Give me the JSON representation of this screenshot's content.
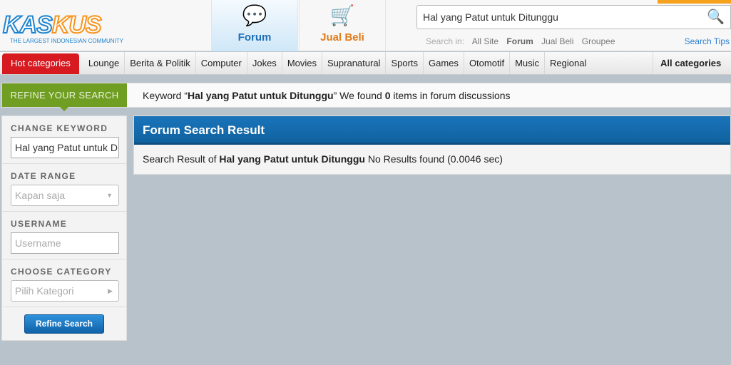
{
  "logo": {
    "text_blue": "KAS",
    "text_orange": "KUS",
    "tagline": "THE LARGEST INDONESIAN COMMUNITY"
  },
  "nav": {
    "forum": "Forum",
    "jual_beli": "Jual Beli"
  },
  "search": {
    "value": "Hal yang Patut untuk Ditunggu",
    "search_in_label": "Search in:",
    "scopes": [
      "All Site",
      "Forum",
      "Jual Beli",
      "Groupee"
    ],
    "active_scope": "Forum",
    "tips": "Search Tips"
  },
  "categories": {
    "hot": "Hot categories",
    "items": [
      "Lounge",
      "Berita & Politik",
      "Computer",
      "Jokes",
      "Movies",
      "Supranatural",
      "Sports",
      "Games",
      "Otomotif",
      "Music",
      "Regional"
    ],
    "all": "All categories"
  },
  "refine_bar": {
    "button": "REFINE YOUR SEARCH",
    "keyword_prefix": "Keyword “",
    "keyword": "Hal yang Patut untuk Ditunggu",
    "keyword_suffix": "” We found ",
    "count": "0",
    "count_suffix": " items in forum discussions"
  },
  "sidebar": {
    "change_keyword": "CHANGE KEYWORD",
    "keyword_value": "Hal yang Patut untuk Ditunggu",
    "date_range": "DATE RANGE",
    "date_value": "Kapan saja",
    "username": "USERNAME",
    "username_placeholder": "Username",
    "category": "CHOOSE CATEGORY",
    "category_value": "Pilih Kategori",
    "submit": "Refine Search"
  },
  "result": {
    "title": "Forum Search Result",
    "prefix": "Search Result of ",
    "keyword": "Hal yang Patut untuk Ditunggu",
    "suffix": " No Results found (0.0046 sec)"
  },
  "colors": {
    "brand_blue": "#1f84cf",
    "brand_orange": "#f7941d",
    "hot_red": "#d71920",
    "refine_green": "#6f9e22",
    "header_blue": "#1a74bb"
  }
}
